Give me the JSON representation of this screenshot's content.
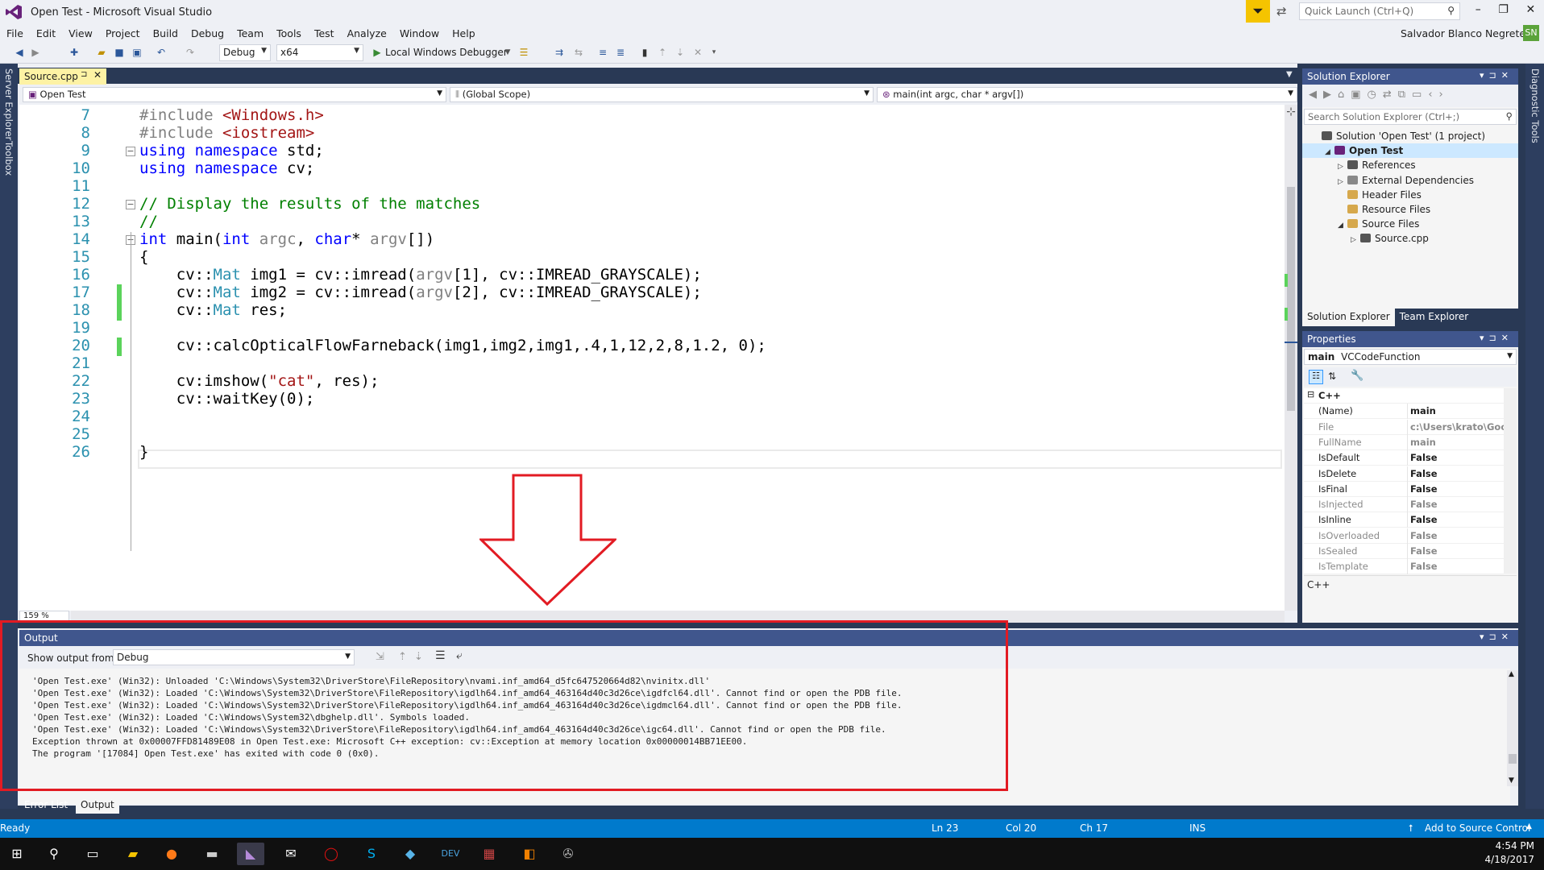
{
  "window": {
    "title": "Open Test - Microsoft Visual Studio",
    "quick_launch_placeholder": "Quick Launch (Ctrl+Q)",
    "user": "Salvador Blanco Negrete",
    "user_initials": "SN"
  },
  "menu": [
    "File",
    "Edit",
    "View",
    "Project",
    "Build",
    "Debug",
    "Team",
    "Tools",
    "Test",
    "Analyze",
    "Window",
    "Help"
  ],
  "toolbar": {
    "config": "Debug",
    "platform": "x64",
    "debugger": "Local Windows Debugger"
  },
  "left_strip": [
    "Server Explorer",
    "Toolbox"
  ],
  "right_strip": [
    "Diagnostic Tools"
  ],
  "editor": {
    "tab": "Source.cpp",
    "nav": {
      "project": "Open Test",
      "scope": "(Global Scope)",
      "member": "main(int argc, char * argv[])"
    },
    "zoom": "159 %",
    "lines": [
      {
        "n": "7",
        "html": "<span class=\"pp\">#include</span> <span class=\"st\">&lt;Windows.h&gt;</span>"
      },
      {
        "n": "8",
        "html": "<span class=\"pp\">#include</span> <span class=\"st\">&lt;iostream&gt;</span>"
      },
      {
        "n": "9",
        "html": "<span class=\"kw\">using</span> <span class=\"kw\">namespace</span> std;"
      },
      {
        "n": "10",
        "html": "<span class=\"kw\">using</span> <span class=\"kw\">namespace</span> cv;"
      },
      {
        "n": "11",
        "html": ""
      },
      {
        "n": "12",
        "html": "<span class=\"cm\">// Display the results of the matches</span>"
      },
      {
        "n": "13",
        "html": "<span class=\"cm\">//</span>"
      },
      {
        "n": "14",
        "html": "<span class=\"kw\">int</span> main(<span class=\"kw\">int</span> <span class=\"pm\">argc</span>, <span class=\"kw\">char</span>* <span class=\"pm\">argv</span>[])"
      },
      {
        "n": "15",
        "html": "{"
      },
      {
        "n": "16",
        "html": "    cv::<span class=\"ty\">Mat</span> img1 = cv::imread(<span class=\"pm\">argv</span>[1], cv::IMREAD_GRAYSCALE);"
      },
      {
        "n": "17",
        "html": "    cv::<span class=\"ty\">Mat</span> img2 = cv::imread(<span class=\"pm\">argv</span>[2], cv::IMREAD_GRAYSCALE);"
      },
      {
        "n": "18",
        "html": "    cv::<span class=\"ty\">Mat</span> res;"
      },
      {
        "n": "19",
        "html": ""
      },
      {
        "n": "20",
        "html": "    cv::calcOpticalFlowFarneback(img1,img2,img1,.4,1,12,2,8,1.2, 0);"
      },
      {
        "n": "21",
        "html": ""
      },
      {
        "n": "22",
        "html": "    cv:imshow(<span class=\"st\">\"cat\"</span>, res);"
      },
      {
        "n": "23",
        "html": "    cv::waitKey(0);"
      },
      {
        "n": "24",
        "html": ""
      },
      {
        "n": "25",
        "html": ""
      },
      {
        "n": "26",
        "html": "}"
      }
    ]
  },
  "solution_explorer": {
    "title": "Solution Explorer",
    "search_placeholder": "Search Solution Explorer (Ctrl+;)",
    "tree": [
      {
        "label": "Solution 'Open Test' (1 project)",
        "indent": 0,
        "arrow": ""
      },
      {
        "label": "Open Test",
        "indent": 1,
        "arrow": "◢",
        "bold": true
      },
      {
        "label": "References",
        "indent": 2,
        "arrow": "▷"
      },
      {
        "label": "External Dependencies",
        "indent": 2,
        "arrow": "▷"
      },
      {
        "label": "Header Files",
        "indent": 2,
        "arrow": ""
      },
      {
        "label": "Resource Files",
        "indent": 2,
        "arrow": ""
      },
      {
        "label": "Source Files",
        "indent": 2,
        "arrow": "◢"
      },
      {
        "label": "Source.cpp",
        "indent": 3,
        "arrow": "▷"
      }
    ],
    "tabs": [
      "Solution Explorer",
      "Team Explorer"
    ]
  },
  "properties": {
    "title": "Properties",
    "object": "main",
    "object_type": "VCCodeFunction",
    "category": "C++",
    "rows": [
      {
        "k": "(Name)",
        "v": "main",
        "dim": false
      },
      {
        "k": "File",
        "v": "c:\\Users\\krato\\Goog",
        "dim": true
      },
      {
        "k": "FullName",
        "v": "main",
        "dim": true
      },
      {
        "k": "IsDefault",
        "v": "False",
        "dim": false
      },
      {
        "k": "IsDelete",
        "v": "False",
        "dim": false
      },
      {
        "k": "IsFinal",
        "v": "False",
        "dim": false
      },
      {
        "k": "IsInjected",
        "v": "False",
        "dim": true
      },
      {
        "k": "IsInline",
        "v": "False",
        "dim": false
      },
      {
        "k": "IsOverloaded",
        "v": "False",
        "dim": true
      },
      {
        "k": "IsSealed",
        "v": "False",
        "dim": true
      },
      {
        "k": "IsTemplate",
        "v": "False",
        "dim": true
      }
    ],
    "description": "C++"
  },
  "output": {
    "title": "Output",
    "show_from_label": "Show output from:",
    "source": "Debug",
    "lines": [
      "'Open Test.exe' (Win32): Unloaded 'C:\\Windows\\System32\\DriverStore\\FileRepository\\nvami.inf_amd64_d5fc647520664d82\\nvinitx.dll'",
      "'Open Test.exe' (Win32): Loaded 'C:\\Windows\\System32\\DriverStore\\FileRepository\\igdlh64.inf_amd64_463164d40c3d26ce\\igdfcl64.dll'. Cannot find or open the PDB file.",
      "'Open Test.exe' (Win32): Loaded 'C:\\Windows\\System32\\DriverStore\\FileRepository\\igdlh64.inf_amd64_463164d40c3d26ce\\igdmcl64.dll'. Cannot find or open the PDB file.",
      "'Open Test.exe' (Win32): Loaded 'C:\\Windows\\System32\\dbghelp.dll'. Symbols loaded.",
      "'Open Test.exe' (Win32): Loaded 'C:\\Windows\\System32\\DriverStore\\FileRepository\\igdlh64.inf_amd64_463164d40c3d26ce\\igc64.dll'. Cannot find or open the PDB file.",
      "Exception thrown at 0x00007FFD81489E08 in Open Test.exe: Microsoft C++ exception: cv::Exception at memory location 0x00000014BB71EE00.",
      "The program '[17084] Open Test.exe' has exited with code 0 (0x0)."
    ],
    "bottom_tabs": [
      "Error List",
      "Output"
    ]
  },
  "status": {
    "ready": "Ready",
    "ln": "Ln 23",
    "col": "Col 20",
    "ch": "Ch 17",
    "ins": "INS",
    "source_control": "Add to Source Control"
  },
  "clock": {
    "time": "4:54 PM",
    "date": "4/18/2017"
  },
  "colors": {
    "accent": "#007acc",
    "selection": "#fdf2a4",
    "annotation_red": "#e21b23"
  }
}
